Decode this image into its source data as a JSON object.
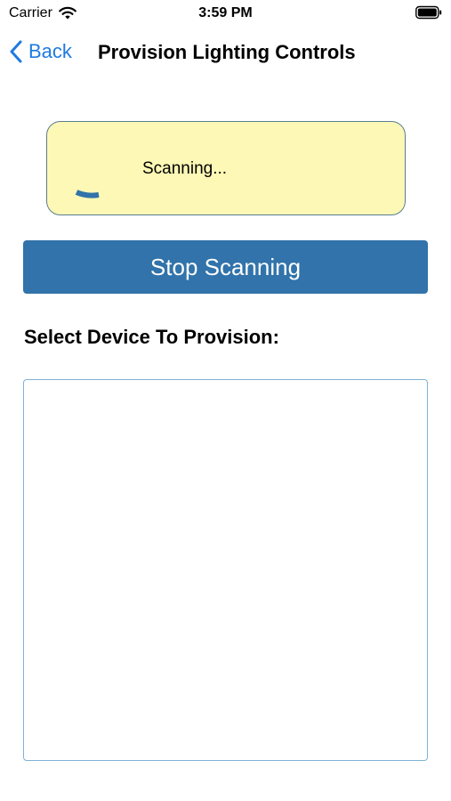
{
  "status_bar": {
    "carrier": "Carrier",
    "time": "3:59 PM",
    "icons": [
      "wifi-icon",
      "battery-icon"
    ]
  },
  "nav": {
    "back_label": "Back",
    "title": "Provision Lighting Controls",
    "accent_color": "#1f7ae0"
  },
  "scan_card": {
    "status_text": "Scanning...",
    "background_color": "#fdf8b5",
    "icon": "spinner-icon"
  },
  "actions": {
    "stop_label": "Stop Scanning",
    "button_color": "#3173aa"
  },
  "device_section": {
    "label": "Select Device To Provision:",
    "items": []
  }
}
